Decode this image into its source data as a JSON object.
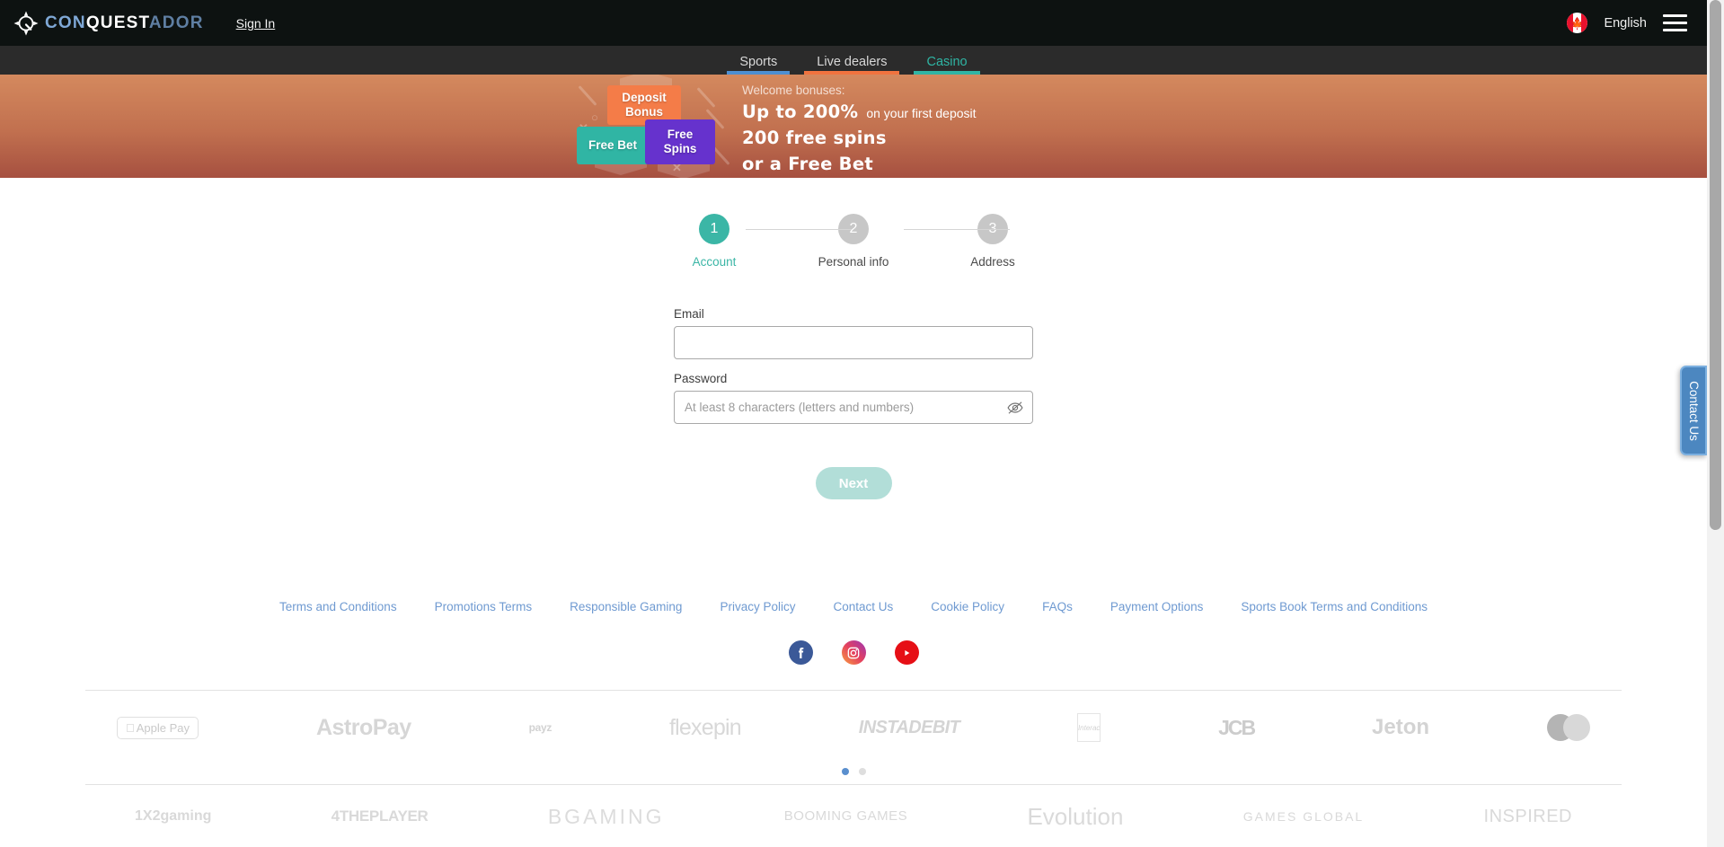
{
  "header": {
    "brand": {
      "logo_icon": "compass-q-logo-icon",
      "text_part1": "CON",
      "text_part2": "QUEST",
      "text_part3": "ADOR"
    },
    "sign_in": "Sign In",
    "language": {
      "flag_icon": "canada-flag-icon",
      "label": "English"
    },
    "menu_icon": "hamburger-menu-icon"
  },
  "nav": {
    "tabs": [
      {
        "label": "Sports",
        "color": "#4e8fd1",
        "active": false
      },
      {
        "label": "Live dealers",
        "color": "#f0733f",
        "active": false
      },
      {
        "label": "Casino",
        "color": "#2fb5a4",
        "active": true
      }
    ]
  },
  "banner": {
    "badges": [
      {
        "label": "Deposit Bonus",
        "line1": "Deposit",
        "line2": "Bonus",
        "color": "#f47c48"
      },
      {
        "label": "Free Bet",
        "line1": "Free Bet",
        "line2": "",
        "color": "#30b5a4"
      },
      {
        "label": "Free Spins",
        "line1": "Free",
        "line2": "Spins",
        "color": "#6632cd"
      }
    ],
    "welcome_label": "Welcome bonuses:",
    "line1_big": "Up to 200%",
    "line1_small": "on your first deposit",
    "line2": "200 free spins",
    "line3": "or a Free Bet"
  },
  "stepper": {
    "steps": [
      {
        "number": "1",
        "label": "Account",
        "active": true
      },
      {
        "number": "2",
        "label": "Personal info",
        "active": false
      },
      {
        "number": "3",
        "label": "Address",
        "active": false
      }
    ]
  },
  "form": {
    "email": {
      "label": "Email",
      "value": "",
      "placeholder": ""
    },
    "password": {
      "label": "Password",
      "value": "",
      "placeholder": "At least 8 characters (letters and numbers)",
      "toggle_icon": "eye-slash-icon"
    },
    "next_button": "Next",
    "next_button_color": "#b2ded8"
  },
  "footer": {
    "links": [
      "Terms and Conditions",
      "Promotions Terms",
      "Responsible Gaming",
      "Privacy Policy",
      "Contact Us",
      "Cookie Policy",
      "FAQs",
      "Payment Options",
      "Sports Book Terms and Conditions"
    ],
    "link_color": "#6f9ad1",
    "socials": [
      {
        "name": "facebook-icon",
        "glyph": "f",
        "color": "#3b5998"
      },
      {
        "name": "instagram-icon",
        "glyph": "◎",
        "color": "#e4405f"
      },
      {
        "name": "youtube-icon",
        "glyph": "▶",
        "color": "#e60f16"
      }
    ],
    "payment_methods": [
      "Apple Pay",
      "AstroPay",
      "payz",
      "flexepin",
      "INSTADEBIT",
      "Interac",
      "JCB",
      "Jeton",
      "Mastercard"
    ],
    "carousel_dots": [
      {
        "active": true
      },
      {
        "active": false
      }
    ],
    "carousel_active_color": "#5a8fce",
    "providers": [
      "1X2gaming",
      "4THEPLAYER",
      "BGAMING",
      "BOOMING GAMES",
      "Evolution",
      "GAMES GLOBAL",
      "INSPIRED"
    ]
  },
  "contact_tab": {
    "label": "Contact Us",
    "color": "#4c87c0"
  }
}
